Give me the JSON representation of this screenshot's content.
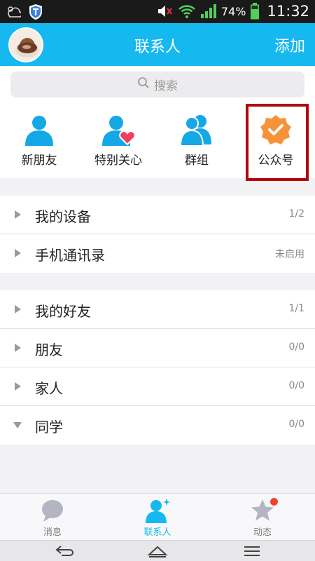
{
  "status_bar": {
    "battery_percent": "74%",
    "time": "11:32",
    "icons": [
      "weather-icon",
      "shield-app-icon",
      "mute-icon",
      "wifi-icon",
      "signal-icon",
      "battery-icon"
    ]
  },
  "header": {
    "title": "联系人",
    "action_label": "添加",
    "accent_color": "#16b8f0"
  },
  "search": {
    "placeholder": "搜索"
  },
  "quick_entries": [
    {
      "label": "新朋友",
      "icon": "person-icon"
    },
    {
      "label": "特别关心",
      "icon": "person-heart-icon"
    },
    {
      "label": "群组",
      "icon": "group-icon"
    },
    {
      "label": "公众号",
      "icon": "verified-badge-icon"
    }
  ],
  "groups_top": [
    {
      "name": "我的设备",
      "count": "1/2",
      "expanded": false
    },
    {
      "name": "手机通讯录",
      "count": "未启用",
      "expanded": false
    }
  ],
  "groups_friends": [
    {
      "name": "我的好友",
      "count": "1/1",
      "expanded": false
    },
    {
      "name": "朋友",
      "count": "0/0",
      "expanded": false
    },
    {
      "name": "家人",
      "count": "0/0",
      "expanded": false
    },
    {
      "name": "同学",
      "count": "0/0",
      "expanded": true
    }
  ],
  "tabs": [
    {
      "label": "消息",
      "icon": "chat-bubble-icon",
      "active": false
    },
    {
      "label": "联系人",
      "icon": "contacts-icon",
      "active": true
    },
    {
      "label": "动态",
      "icon": "star-icon",
      "active": false,
      "badge": true
    }
  ],
  "nav_bar": {
    "buttons": [
      "back-icon",
      "home-icon",
      "menu-icon"
    ]
  }
}
